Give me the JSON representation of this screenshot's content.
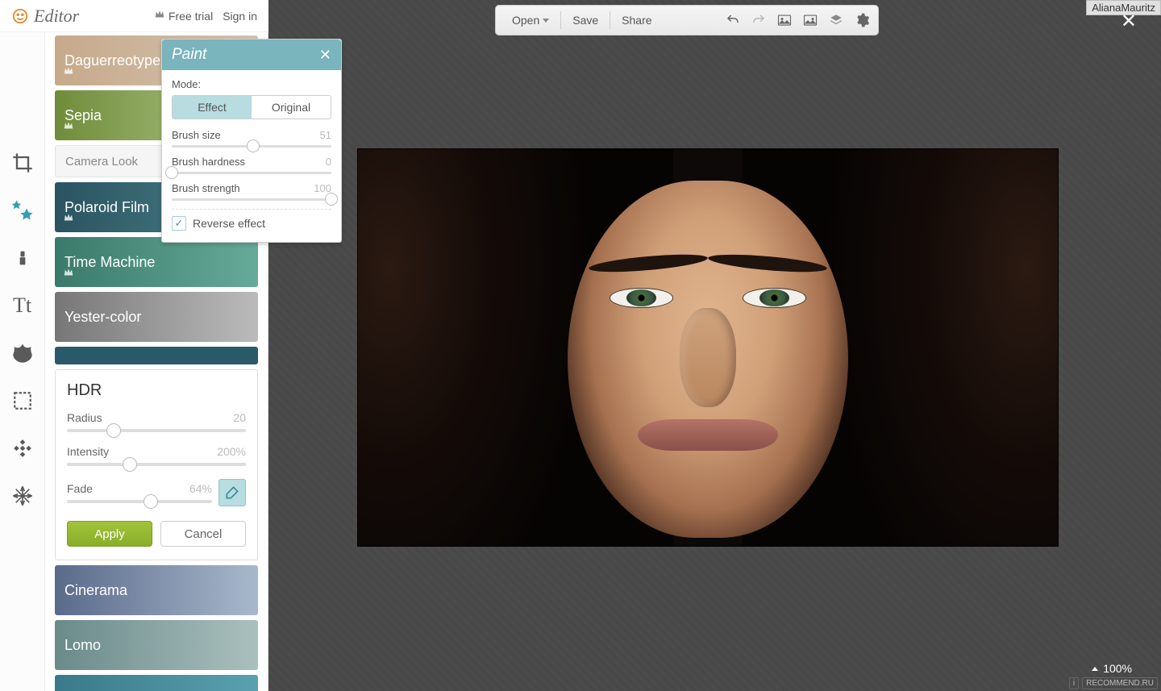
{
  "header": {
    "app_name": "Editor",
    "free_trial": "Free trial",
    "sign_in": "Sign in"
  },
  "toolbar": {
    "open": "Open",
    "save": "Save",
    "share": "Share"
  },
  "left_tools": [
    "crop",
    "effects",
    "touchup",
    "text",
    "overlay",
    "frame",
    "texture",
    "snowflake"
  ],
  "effects": {
    "daguerreotype": "Daguerreotype",
    "sepia": "Sepia",
    "camera_look": "Camera Look",
    "polaroid": "Polaroid Film",
    "time_machine": "Time Machine",
    "yester": "Yester-color",
    "cinerama": "Cinerama",
    "lomo": "Lomo"
  },
  "hdr": {
    "title": "HDR",
    "radius_label": "Radius",
    "radius_value": "20",
    "radius_pct": 26,
    "intensity_label": "Intensity",
    "intensity_value": "200%",
    "intensity_pct": 35,
    "fade_label": "Fade",
    "fade_value": "64%",
    "fade_pct": 58,
    "apply": "Apply",
    "cancel": "Cancel"
  },
  "paint": {
    "title": "Paint",
    "mode_label": "Mode:",
    "effect": "Effect",
    "original": "Original",
    "brush_size_label": "Brush size",
    "brush_size_value": "51",
    "brush_size_pct": 51,
    "brush_hardness_label": "Brush hardness",
    "brush_hardness_value": "0",
    "brush_hardness_pct": 0,
    "brush_strength_label": "Brush strength",
    "brush_strength_value": "100",
    "brush_strength_pct": 100,
    "reverse": "Reverse effect"
  },
  "user": "AlianaMauritz",
  "zoom": "100%",
  "attribution": "RECOMMEND.RU"
}
